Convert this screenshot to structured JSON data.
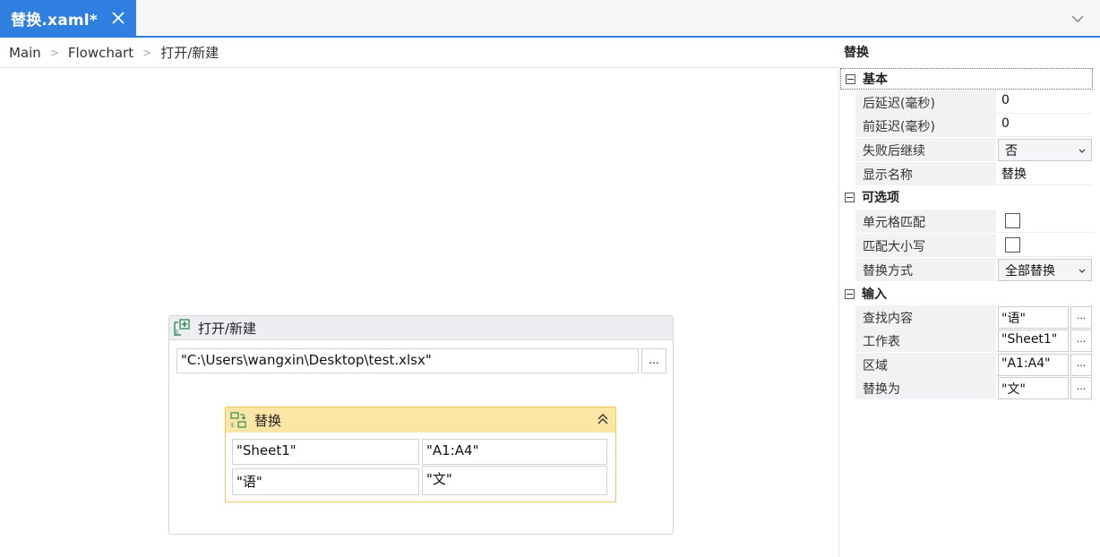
{
  "tab": {
    "title": "替换.xaml*"
  },
  "breadcrumb": [
    "Main",
    "Flowchart",
    "打开/新建"
  ],
  "sequence": {
    "title": "打开/新建",
    "path": "\"C:\\Users\\wangxin\\Desktop\\test.xlsx\"",
    "ellipsis": "...",
    "activity": {
      "title": "替换",
      "sheet": "\"Sheet1\"",
      "range": "\"A1:A4\"",
      "find": "\"语\"",
      "replace": "\"文\""
    }
  },
  "properties": {
    "title": "替换",
    "categories": {
      "basic": "基本",
      "options": "可选项",
      "input": "输入"
    },
    "basic": {
      "delay_after_label": "后延迟(毫秒)",
      "delay_after_value": "0",
      "delay_before_label": "前延迟(毫秒)",
      "delay_before_value": "0",
      "continue_on_error_label": "失败后继续",
      "continue_on_error_value": "否",
      "display_name_label": "显示名称",
      "display_name_value": "替换"
    },
    "options": {
      "cell_match_label": "单元格匹配",
      "match_case_label": "匹配大小写",
      "replace_mode_label": "替换方式",
      "replace_mode_value": "全部替换"
    },
    "input": {
      "find_label": "查找内容",
      "find_value": "\"语\"",
      "sheet_label": "工作表",
      "sheet_value": "\"Sheet1\"",
      "range_label": "区域",
      "range_value": "\"A1:A4\"",
      "replace_label": "替换为",
      "replace_value": "\"文\"",
      "btn": "..."
    }
  },
  "colors": {
    "accent": "#2f7fe0",
    "activity_header": "#fbe6a6",
    "activity_border": "#f1c75a"
  }
}
